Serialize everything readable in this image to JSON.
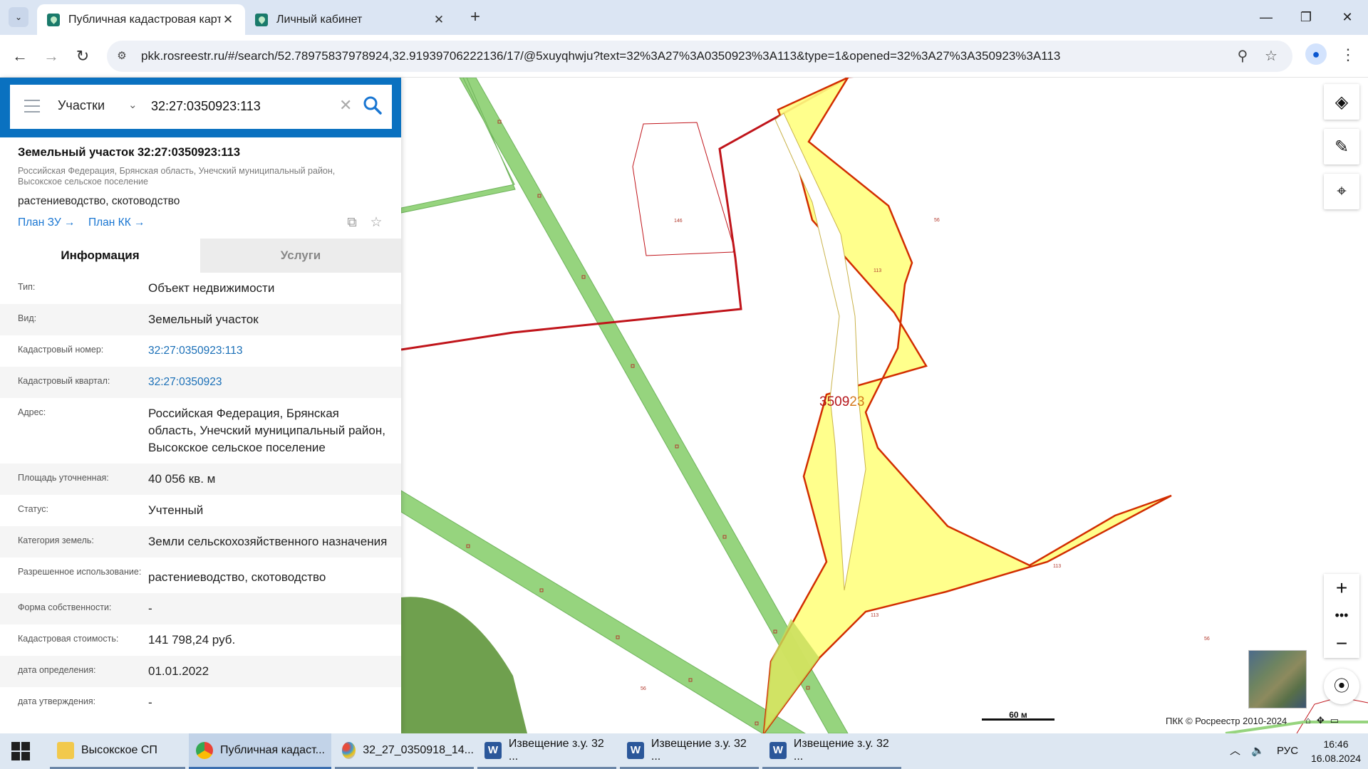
{
  "browser": {
    "tabs": [
      {
        "title": "Публичная кадастровая карта",
        "active": true
      },
      {
        "title": "Личный кабинет",
        "active": false
      }
    ],
    "url": "pkk.rosreestr.ru/#/search/52.78975837978924,32.91939706222136/17/@5xuyqhwju?text=32%3A27%3A0350923%3A113&type=1&opened=32%3A27%3A350923%3A113"
  },
  "search": {
    "category": "Участки",
    "query": "32:27:0350923:113"
  },
  "object": {
    "title": "Земельный участок 32:27:0350923:113",
    "address_line1": "Российская Федерация, Брянская область, Унечский муниципальный район,",
    "address_line2": "Высокское сельское поселение",
    "use": "растениеводство, скотоводство",
    "plan_zu": "План ЗУ",
    "plan_kk": "План КК"
  },
  "panel_tabs": {
    "info": "Информация",
    "services": "Услуги"
  },
  "info_rows": [
    {
      "key": "Тип:",
      "value": "Объект недвижимости",
      "link": false
    },
    {
      "key": "Вид:",
      "value": "Земельный участок",
      "link": false
    },
    {
      "key": "Кадастровый номер:",
      "value": "32:27:0350923:113",
      "link": true
    },
    {
      "key": "Кадастровый квартал:",
      "value": "32:27:0350923",
      "link": true
    },
    {
      "key": "Адрес:",
      "value": "Российская Федерация, Брянская область, Унечский муниципальный район, Высокское сельское поселение",
      "link": false
    },
    {
      "key": "Площадь уточненная:",
      "value": "40 056 кв. м",
      "link": false
    },
    {
      "key": "Статус:",
      "value": "Учтенный",
      "link": false
    },
    {
      "key": "Категория земель:",
      "value": "Земли сельскохозяйственного назначения",
      "link": false
    },
    {
      "key": "Разрешенное использование:",
      "value": "растениеводство, скотоводство",
      "link": false
    },
    {
      "key": "Форма собственности:",
      "value": "-",
      "link": false
    },
    {
      "key": "Кадастровая стоимость:",
      "value": "141 798,24 руб.",
      "link": false
    },
    {
      "key": "дата определения:",
      "value": "01.01.2022",
      "link": false
    },
    {
      "key": "дата утверждения:",
      "value": "-",
      "link": false
    }
  ],
  "map": {
    "quarter_label_a": "3509",
    "quarter_label_b": "23",
    "parcel_labels": {
      "l146": "146",
      "l113a": "113",
      "l113b": "113",
      "l113c": "113",
      "l56a": "56",
      "l56b": "56",
      "l56c": "56"
    },
    "scale": "60 м",
    "copyright": "ПКК © Росреестр 2010-2024",
    "colors": {
      "parcel_fill": "#ffff80",
      "parcel_border": "#d22d00",
      "road_fill": "#96d47e",
      "forest_fill": "#6fa04e",
      "quarter_border": "#c0141a"
    }
  },
  "taskbar": {
    "items": [
      {
        "label": "Высокское СП",
        "icon": "folder-icon"
      },
      {
        "label": "Публичная кадаст...",
        "icon": "chrome-icon"
      },
      {
        "label": "32_27_0350918_14...",
        "icon": "paint-icon"
      },
      {
        "label": "Извещение з.у. 32 ...",
        "icon": "word-icon"
      },
      {
        "label": "Извещение з.у. 32 ...",
        "icon": "word-icon"
      },
      {
        "label": "Извещение з.у. 32 ...",
        "icon": "word-icon"
      }
    ],
    "lang": "РУС",
    "time": "16:46",
    "date": "16.08.2024"
  }
}
